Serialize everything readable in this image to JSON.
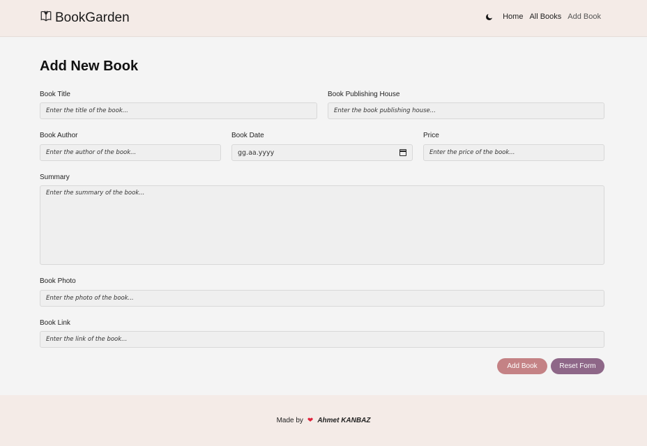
{
  "navbar": {
    "brand": "BookGarden",
    "links": [
      {
        "label": "Home"
      },
      {
        "label": "All Books"
      },
      {
        "label": "Add Book"
      }
    ]
  },
  "page": {
    "title": "Add New Book"
  },
  "form": {
    "title": {
      "label": "Book Title",
      "placeholder": "Enter the title of the book..."
    },
    "publisher": {
      "label": "Book Publishing House",
      "placeholder": "Enter the book publishing house..."
    },
    "author": {
      "label": "Book Author",
      "placeholder": "Enter the author of the book..."
    },
    "date": {
      "label": "Book Date",
      "placeholder": "gg.aa.yyyy"
    },
    "price": {
      "label": "Price",
      "placeholder": "Enter the price of the book..."
    },
    "summary": {
      "label": "Summary",
      "placeholder": "Enter the summary of the book..."
    },
    "photo": {
      "label": "Book Photo",
      "placeholder": "Enter the photo of the book..."
    },
    "link": {
      "label": "Book Link",
      "placeholder": "Enter the link of the book..."
    },
    "add_button": "Add Book",
    "reset_button": "Reset Form"
  },
  "footer": {
    "made_by": "Made by",
    "heart": "❤",
    "author": "Ahmet KANBAZ"
  },
  "colors": {
    "header_bg": "#f4ebe7",
    "page_bg": "#f4f4f4",
    "add_button": "#c48285",
    "reset_button": "#8e6788"
  }
}
